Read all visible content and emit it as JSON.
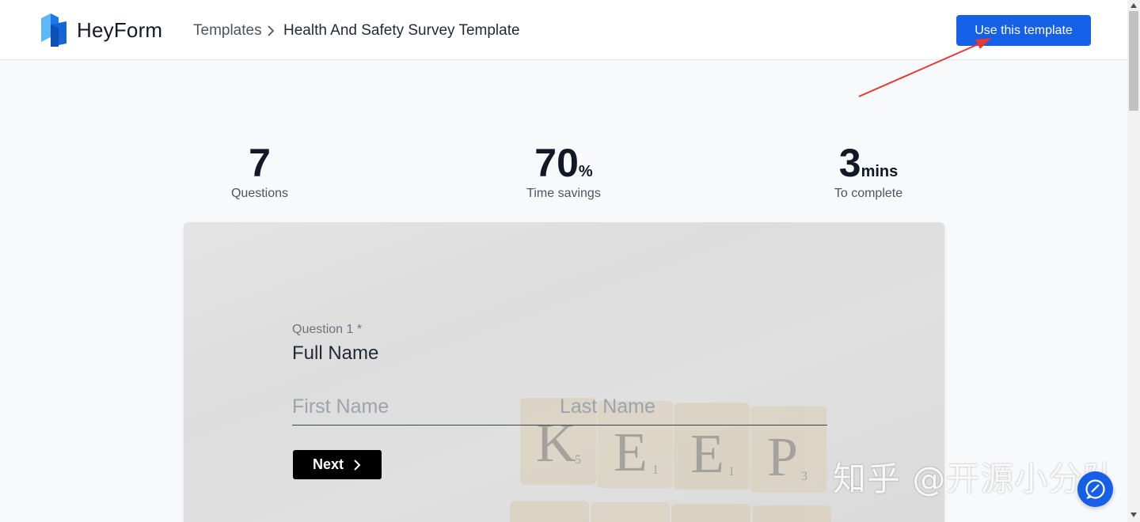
{
  "header": {
    "brand": "HeyForm",
    "breadcrumb_root": "Templates",
    "breadcrumb_current": "Health And Safety Survey Template",
    "cta_label": "Use this template"
  },
  "stats": [
    {
      "value": "7",
      "unit": "",
      "label": "Questions"
    },
    {
      "value": "70",
      "unit": "%",
      "label": "Time savings"
    },
    {
      "value": "3",
      "unit": "mins",
      "label": "To complete"
    }
  ],
  "form": {
    "question_label": "Question 1 *",
    "question_title": "Full Name",
    "first_placeholder": "First Name",
    "last_placeholder": "Last Name",
    "next_label": "Next",
    "tile_letters": [
      "K",
      "E",
      "E",
      "P"
    ],
    "tile_scores": [
      "5",
      "1",
      "1",
      "3"
    ]
  },
  "watermark": "知乎 @开源小分队",
  "colors": {
    "accent": "#1560e6",
    "annotation_arrow": "#e53935"
  },
  "icons": {
    "logo": "heyform-logo-icon",
    "breadcrumb_separator": "chevron-right-icon",
    "next": "chevron-right-icon",
    "help": "help-chat-icon"
  }
}
